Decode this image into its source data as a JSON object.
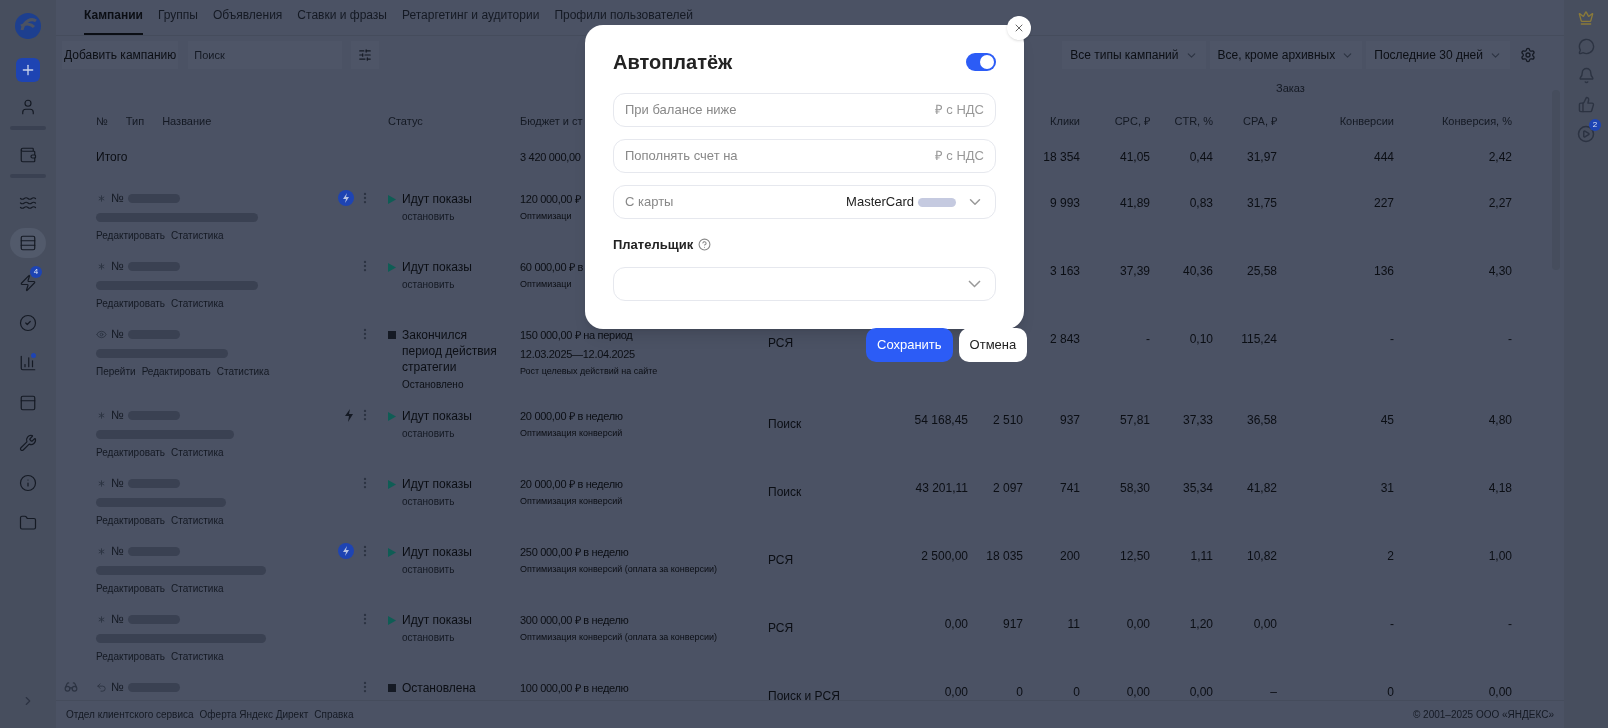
{
  "sidebar": {
    "items": [
      {
        "selected": false
      },
      {
        "selected": false
      },
      {
        "selected": false
      },
      {
        "selected": true
      },
      {
        "selected": false,
        "badge": "4"
      },
      {
        "selected": false
      },
      {
        "selected": false,
        "dot": true
      },
      {
        "selected": false
      },
      {
        "selected": false
      },
      {
        "selected": false
      },
      {
        "selected": false
      }
    ]
  },
  "tabs": [
    {
      "label": "Кампании",
      "selected": true
    },
    {
      "label": "Группы",
      "selected": false
    },
    {
      "label": "Объявления",
      "selected": false
    },
    {
      "label": "Ставки и фразы",
      "selected": false
    },
    {
      "label": "Ретаргетинг и аудитории",
      "selected": false
    },
    {
      "label": "Профили пользователей",
      "selected": false
    }
  ],
  "toolbar": {
    "add_button": "Добавить кампанию",
    "search": {
      "placeholder": "Поиск"
    },
    "filters": [
      "Все типы кампаний",
      "Все, кроме архивных",
      "Последние 30 дней"
    ]
  },
  "table": {
    "group_header": "Заказ",
    "columns": {
      "number": "№",
      "type": "Тип",
      "name": "Название",
      "status": "Статус",
      "budget": "Бюджет и ст",
      "clicks": "Клики",
      "cpc": "CPC, ₽",
      "ctr": "CTR, %",
      "cpa": "CPA, ₽",
      "conversions": "Конверсии",
      "conversion_rate": "Конверсия, %"
    },
    "total": {
      "label": "Итого",
      "budget": "3 420 000,00",
      "clicks": "18 354",
      "cpc": "41,05",
      "ctr": "0,44",
      "cpa": "31,97",
      "conversions": "444",
      "conversion_rate": "2,42"
    },
    "rows": [
      {
        "kind": "text",
        "side_icon": false,
        "number_label": "№",
        "lightning": {
          "kind": "filled"
        },
        "links": [
          "Редактировать",
          "Статистика"
        ],
        "status": {
          "kind": "running",
          "text": "Идут показы"
        },
        "note": {
          "kind": "link",
          "text": "остановить"
        },
        "budget": [
          "120 000,00 ₽"
        ],
        "strategy": "Оптимизаци",
        "clicks": "9 993",
        "cpc": "41,89",
        "ctr": "0,83",
        "cpa": "31,75",
        "conversions": "227",
        "conversion_rate": "2,27"
      },
      {
        "kind": "text",
        "side_icon": false,
        "number_label": "№",
        "links": [
          "Редактировать",
          "Статистика"
        ],
        "status": {
          "kind": "running",
          "text": "Идут показы"
        },
        "note": {
          "kind": "link",
          "text": "остановить"
        },
        "budget": [
          "60 000,00 ₽ в"
        ],
        "strategy": "Оптимизаци",
        "clicks": "3 163",
        "cpc": "37,39",
        "ctr": "40,36",
        "cpa": "25,58",
        "conversions": "136",
        "conversion_rate": "4,30"
      },
      {
        "kind": "site",
        "side_icon": false,
        "number_label": "№",
        "links": [
          "Перейти",
          "Редактировать",
          "Статистика"
        ],
        "status": {
          "kind": "stopped",
          "text": "Закончился период действия стратегии"
        },
        "note": {
          "kind": "text",
          "text": "Остановлено"
        },
        "budget": [
          "150 000,00 ₽ на период",
          "12.03.2025—12.04.2025"
        ],
        "strategy": "Рост целевых действий на сайте",
        "type": "РСЯ",
        "clicks": "2 843",
        "cpc": "-",
        "ctr": "0,10",
        "cpa": "115,24",
        "conversions": "-",
        "conversion_rate": "-"
      },
      {
        "kind": "text",
        "side_icon": false,
        "number_label": "№",
        "lightning": {
          "kind": "plain"
        },
        "links": [
          "Редактировать",
          "Статистика"
        ],
        "status": {
          "kind": "running",
          "text": "Идут показы"
        },
        "note": {
          "kind": "link",
          "text": "остановить"
        },
        "budget": [
          "20 000,00 ₽ в неделю"
        ],
        "strategy": "Оптимизация конверсий",
        "type": "Поиск",
        "column_6": "54 168,45",
        "column_7": "2 510",
        "clicks": "937",
        "cpc": "57,81",
        "ctr": "37,33",
        "cpa": "36,58",
        "conversions": "45",
        "conversion_rate": "4,80"
      },
      {
        "kind": "text",
        "side_icon": false,
        "number_label": "№",
        "links": [
          "Редактировать",
          "Статистика"
        ],
        "status": {
          "kind": "running",
          "text": "Идут показы"
        },
        "note": {
          "kind": "link",
          "text": "остановить"
        },
        "budget": [
          "20 000,00 ₽ в неделю"
        ],
        "strategy": "Оптимизация конверсий",
        "type": "Поиск",
        "column_6": "43 201,11",
        "column_7": "2 097",
        "clicks": "741",
        "cpc": "58,30",
        "ctr": "35,34",
        "cpa": "41,82",
        "conversions": "31",
        "conversion_rate": "4,18"
      },
      {
        "kind": "text",
        "side_icon": false,
        "number_label": "№",
        "lightning": {
          "kind": "filled"
        },
        "links": [
          "Редактировать",
          "Статистика"
        ],
        "status": {
          "kind": "running",
          "text": "Идут показы"
        },
        "note": {
          "kind": "link",
          "text": "остановить"
        },
        "budget": [
          "250 000,00 ₽ в неделю"
        ],
        "strategy": "Оптимизация конверсий (оплата за конверсии)",
        "type": "РСЯ",
        "column_6": "2 500,00",
        "column_7": "18 035",
        "clicks": "200",
        "cpc": "12,50",
        "ctr": "1,11",
        "cpa": "10,82",
        "conversions": "2",
        "conversion_rate": "1,00"
      },
      {
        "kind": "text",
        "side_icon": false,
        "number_label": "№",
        "links": [
          "Редактировать",
          "Статистика"
        ],
        "status": {
          "kind": "running",
          "text": "Идут показы"
        },
        "note": {
          "kind": "link",
          "text": "остановить"
        },
        "budget": [
          "300 000,00 ₽ в неделю"
        ],
        "strategy": "Оптимизация конверсий (оплата за конверсии)",
        "type": "РСЯ",
        "column_6": "0,00",
        "column_7": "917",
        "clicks": "11",
        "cpc": "0,00",
        "ctr": "1,20",
        "cpa": "0,00",
        "conversions": "-",
        "conversion_rate": "-"
      },
      {
        "kind": "unified",
        "side_icon": true,
        "number_label": "№",
        "status": {
          "kind": "stopped",
          "text": "Остановлена"
        },
        "budget": [
          "100 000,00 ₽ в неделю"
        ],
        "type": "Поиск и РСЯ",
        "column_6": "0,00",
        "column_7": "0",
        "clicks": "0",
        "cpc": "0,00",
        "ctr": "0,00",
        "cpa": "–",
        "conversions": "0",
        "conversion_rate": "0,00"
      }
    ]
  },
  "modal": {
    "title": "Автоплатёж",
    "enabled": true,
    "fields": [
      {
        "kind": "input",
        "placeholder": "При балансе ниже",
        "suffix": "₽ с НДС"
      },
      {
        "kind": "input",
        "placeholder": "Пополнять счет на",
        "suffix": "₽ с НДС"
      },
      {
        "kind": "select",
        "label": "С карты",
        "value": "MasterCard"
      }
    ],
    "payer": {
      "label": "Плательщик"
    },
    "buttons": [
      {
        "label": "Сохранить",
        "kind": "primary"
      },
      {
        "label": "Отмена",
        "kind": "secondary"
      }
    ]
  },
  "right_sidebar": {
    "badge": "2"
  },
  "footer": {
    "links": [
      "Отдел клиентского сервиса",
      "Оферта Яндекс Директ",
      "Справка"
    ],
    "copyright": "© 2001–2025 ООО «ЯНДЕКС»"
  }
}
